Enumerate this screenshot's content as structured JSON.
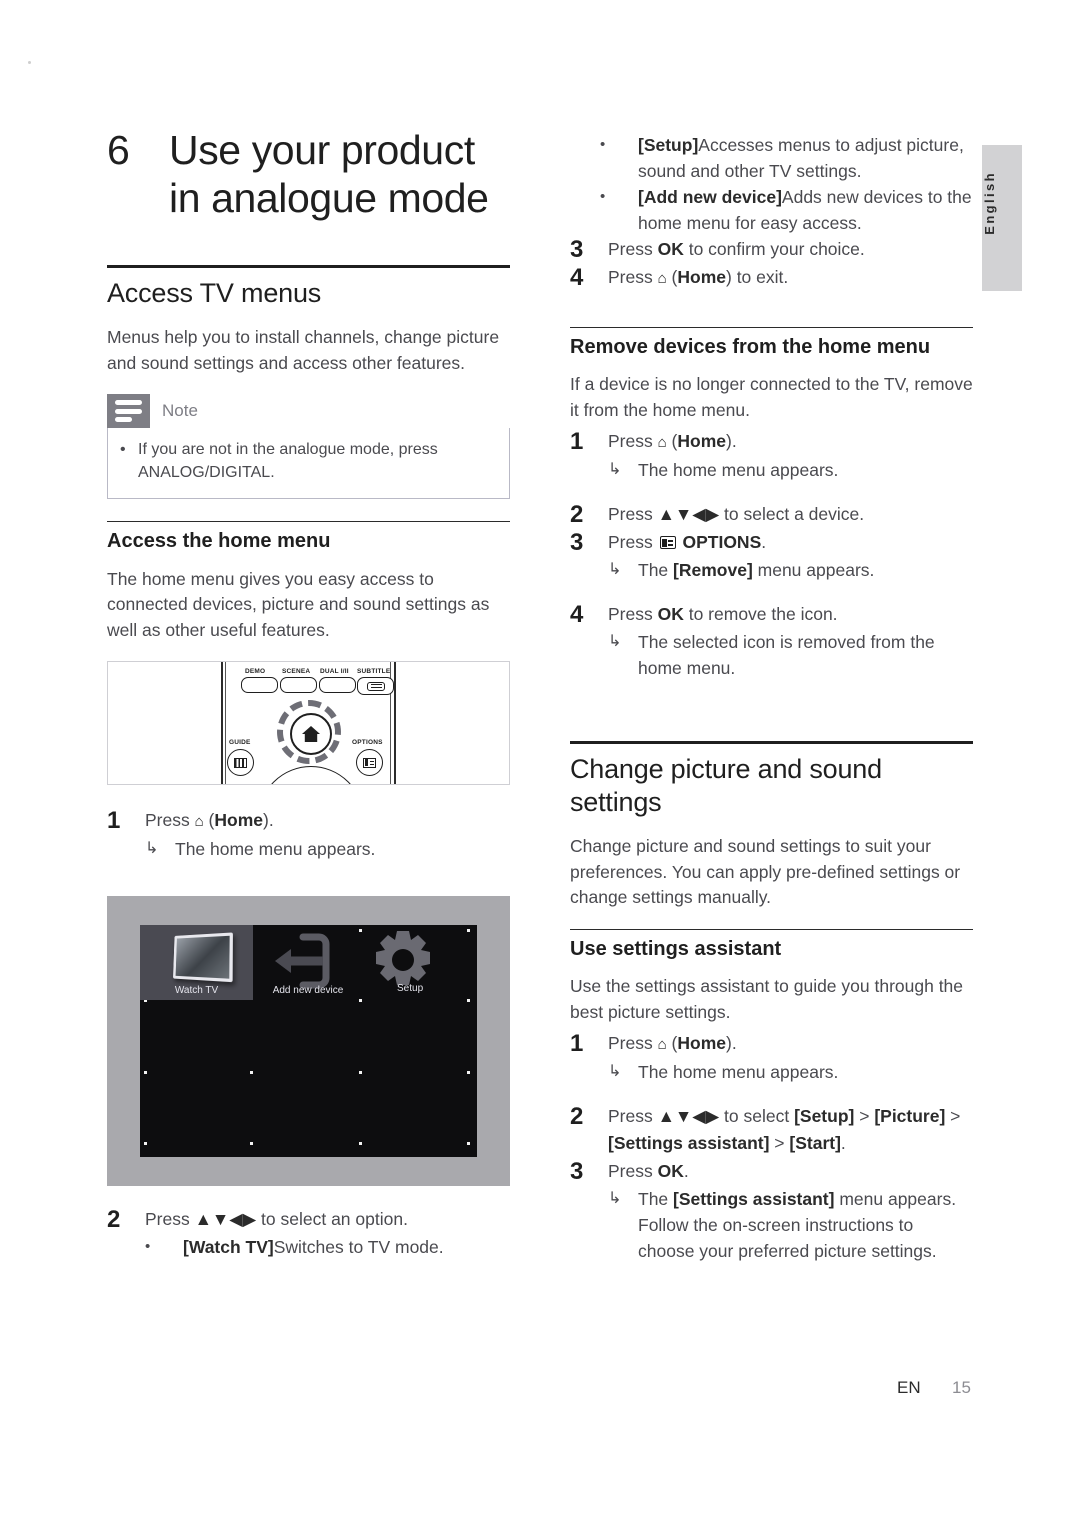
{
  "language_tab": "English",
  "chapter": {
    "number": "6",
    "title_line1": "Use your product",
    "title_line2": "in analogue mode"
  },
  "footer": {
    "lang_code": "EN",
    "page_number": "15"
  },
  "left_column": {
    "section_title": "Access TV menus",
    "intro": "Menus help you to install channels, change picture and sound settings and access other features.",
    "note": {
      "label": "Note",
      "bullet_prefix": "If you are not in the analogue mode, press ",
      "bullet_bold": "ANALOG/DIGITAL",
      "bullet_suffix": "."
    },
    "subsection_title": "Access the home menu",
    "subsection_intro": "The home menu gives you easy access to connected devices, picture and sound settings as well as other useful features.",
    "remote": {
      "buttons": [
        "DEMO",
        "SCENEA",
        "DUAL I/II",
        "SUBTITLE",
        "GUIDE",
        "OPTIONS"
      ],
      "home_icon": "home-icon"
    },
    "tv_screenshot": {
      "tiles": [
        {
          "label": "Watch TV",
          "icon": "tv-panel-icon",
          "selected": true
        },
        {
          "label": "Add new device",
          "icon": "add-device-arrow-icon",
          "selected": false
        },
        {
          "label": "Setup",
          "icon": "gear-icon",
          "selected": false
        }
      ]
    },
    "steps": [
      {
        "num": "1",
        "pre": "Press ",
        "icon": "⌂",
        "mid": " (",
        "bold": "Home",
        "post": ").",
        "sub": {
          "arrow": "↳",
          "text": "The home menu appears."
        }
      },
      {
        "num": "2",
        "pre": "Press ",
        "arrows": "▲▼◀▶",
        "post": " to select an option.",
        "bullet": {
          "dot": "•",
          "bold": "[Watch TV]",
          "text": "Switches to TV mode."
        }
      }
    ]
  },
  "right_column": {
    "top_bullets": [
      {
        "dot": "•",
        "bold": "[Setup]",
        "text": "Accesses menus to adjust picture, sound and other TV settings."
      },
      {
        "dot": "•",
        "bold": "[Add new device]",
        "text": "Adds new devices to the home menu for easy access."
      }
    ],
    "top_steps": [
      {
        "num": "3",
        "pre": "Press ",
        "bold": "OK",
        "post": " to confirm your choice."
      },
      {
        "num": "4",
        "pre": "Press ",
        "icon": "⌂",
        "mid": " (",
        "bold": "Home",
        "post": ") to exit."
      }
    ],
    "remove_section": {
      "title": "Remove devices from the home menu",
      "intro": "If a device is no longer connected to the TV, remove it from the home menu.",
      "steps": [
        {
          "num": "1",
          "pre": "Press ",
          "icon": "⌂",
          "mid": " (",
          "bold": "Home",
          "post": ").",
          "sub": {
            "arrow": "↳",
            "text": "The home menu appears."
          }
        },
        {
          "num": "2",
          "pre": "Press ",
          "arrows": "▲▼◀▶",
          "post": " to select a device."
        },
        {
          "num": "3",
          "pre": "Press ",
          "glyph": "options-icon",
          "bold": "OPTIONS",
          "post": ".",
          "sub": {
            "arrow": "↳",
            "pre": "The ",
            "bold": "[Remove]",
            "post": " menu appears."
          }
        },
        {
          "num": "4",
          "pre": "Press ",
          "bold": "OK",
          "post": " to remove the icon.",
          "sub": {
            "arrow": "↳",
            "text": "The selected icon is removed from the home menu."
          }
        }
      ]
    },
    "change_section": {
      "title_line1": "Change picture and sound",
      "title_line2": "settings",
      "intro": "Change picture and sound settings to suit your preferences. You can apply pre-defined settings or change settings manually.",
      "subsection_title": "Use settings assistant",
      "subsection_intro": "Use the settings assistant to guide you through the best picture settings.",
      "steps": [
        {
          "num": "1",
          "pre": "Press ",
          "icon": "⌂",
          "mid": " (",
          "bold": "Home",
          "post": ").",
          "sub": {
            "arrow": "↳",
            "text": "The home menu appears."
          }
        },
        {
          "num": "2",
          "pre": "Press ",
          "arrows": "▲▼◀▶",
          "mid": " to select ",
          "bold1": "[Setup]",
          "sep1": " > ",
          "bold2": "[Picture]",
          "sep2": " > ",
          "bold3": "[Settings assistant]",
          "sep3": " > ",
          "bold4": "[Start]",
          "post": "."
        },
        {
          "num": "3",
          "pre": "Press ",
          "bold": "OK",
          "post": ".",
          "sub": {
            "arrow": "↳",
            "pre": "The ",
            "bold": "[Settings assistant]",
            "post": " menu appears. Follow the on-screen instructions to choose your preferred picture settings."
          }
        }
      ]
    }
  }
}
